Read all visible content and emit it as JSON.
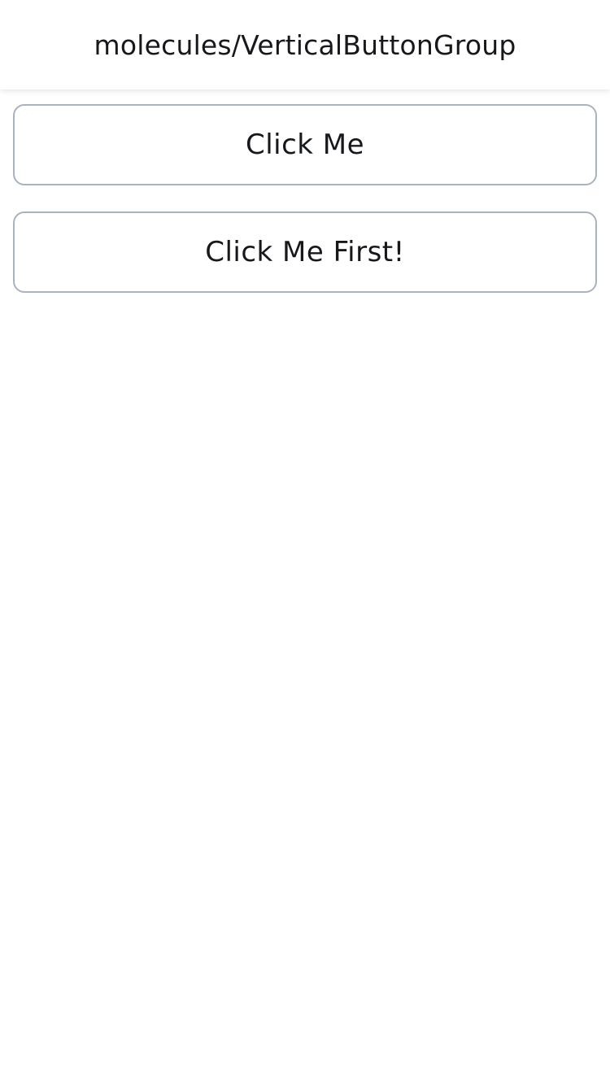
{
  "header": {
    "title": "molecules/VerticalButtonGroup"
  },
  "buttons": [
    {
      "label": "Click Me"
    },
    {
      "label": "Click Me First!"
    }
  ],
  "colors": {
    "border": "#a9b3bf",
    "text": "#16181b",
    "background": "#ffffff"
  }
}
